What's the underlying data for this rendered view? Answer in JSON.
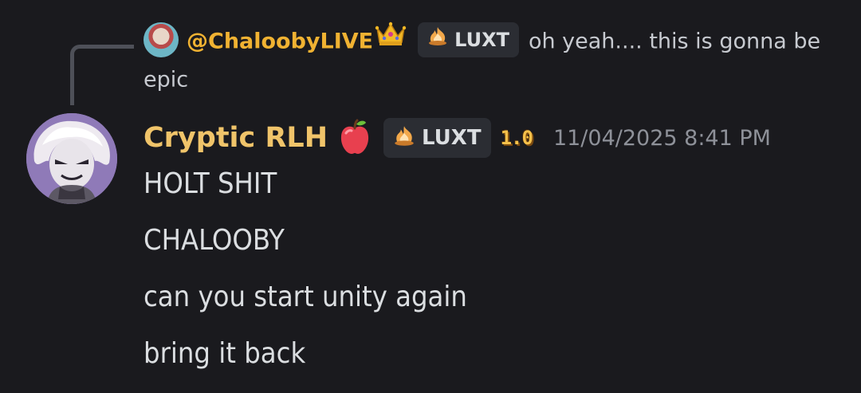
{
  "reply": {
    "author": "@ChaloobyLIVE",
    "tag": "LUXT",
    "text": "oh yeah.... this is gonna be epic",
    "icons": [
      "avatar",
      "crown-icon",
      "flame-icon"
    ]
  },
  "message": {
    "author": "Cryptic RLH",
    "tag": "LUXT",
    "level": "1.0",
    "timestamp": "11/04/2025 8:41 PM",
    "lines": [
      "HOLT SHIT",
      "CHALOOBY",
      "can you start unity again",
      "bring it back"
    ],
    "icons": [
      "avatar",
      "apple-icon",
      "flame-icon"
    ]
  },
  "colors": {
    "background": "#1a1a1e",
    "reply_author": "#f0b232",
    "author": "#f0c46a",
    "text": "#dbdee1",
    "muted": "#8e9199",
    "tag_bg": "#2b2d33"
  }
}
